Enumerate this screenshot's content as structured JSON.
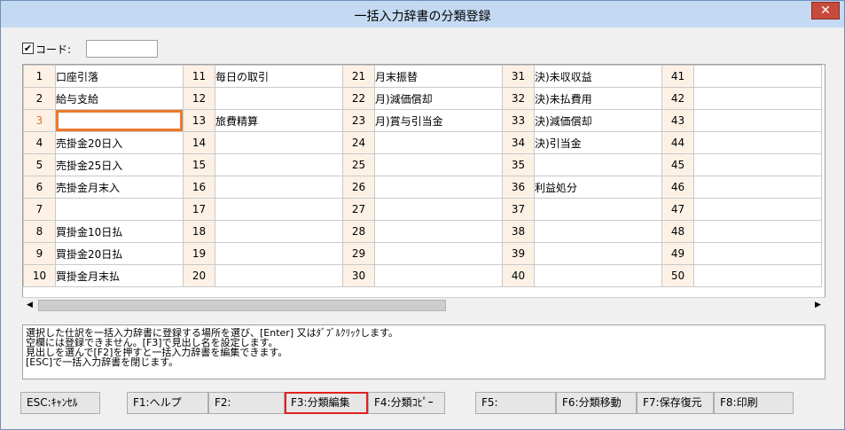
{
  "window": {
    "title": "一括入力辞書の分類登録",
    "close_glyph": "✕"
  },
  "code": {
    "checked": true,
    "check_glyph": "✔",
    "label": "コード:",
    "value": ""
  },
  "grid": {
    "columns": [
      [
        {
          "num": "1",
          "text": "口座引落"
        },
        {
          "num": "2",
          "text": "給与支給"
        },
        {
          "num": "3",
          "text": ""
        },
        {
          "num": "4",
          "text": "売掛金20日入"
        },
        {
          "num": "5",
          "text": "売掛金25日入"
        },
        {
          "num": "6",
          "text": "売掛金月末入"
        },
        {
          "num": "7",
          "text": ""
        },
        {
          "num": "8",
          "text": "買掛金10日払"
        },
        {
          "num": "9",
          "text": "買掛金20日払"
        },
        {
          "num": "10",
          "text": "買掛金月末払"
        }
      ],
      [
        {
          "num": "11",
          "text": "毎日の取引"
        },
        {
          "num": "12",
          "text": ""
        },
        {
          "num": "13",
          "text": "旅費精算"
        },
        {
          "num": "14",
          "text": ""
        },
        {
          "num": "15",
          "text": ""
        },
        {
          "num": "16",
          "text": ""
        },
        {
          "num": "17",
          "text": ""
        },
        {
          "num": "18",
          "text": ""
        },
        {
          "num": "19",
          "text": ""
        },
        {
          "num": "20",
          "text": ""
        }
      ],
      [
        {
          "num": "21",
          "text": "月末振替"
        },
        {
          "num": "22",
          "text": "月)減価償却"
        },
        {
          "num": "23",
          "text": "月)賞与引当金"
        },
        {
          "num": "24",
          "text": ""
        },
        {
          "num": "25",
          "text": ""
        },
        {
          "num": "26",
          "text": ""
        },
        {
          "num": "27",
          "text": ""
        },
        {
          "num": "28",
          "text": ""
        },
        {
          "num": "29",
          "text": ""
        },
        {
          "num": "30",
          "text": ""
        }
      ],
      [
        {
          "num": "31",
          "text": "決)未収収益"
        },
        {
          "num": "32",
          "text": "決)未払費用"
        },
        {
          "num": "33",
          "text": "決)減価償却"
        },
        {
          "num": "34",
          "text": "決)引当金"
        },
        {
          "num": "35",
          "text": ""
        },
        {
          "num": "36",
          "text": "利益処分"
        },
        {
          "num": "37",
          "text": ""
        },
        {
          "num": "38",
          "text": ""
        },
        {
          "num": "39",
          "text": ""
        },
        {
          "num": "40",
          "text": ""
        }
      ],
      [
        {
          "num": "41",
          "text": ""
        },
        {
          "num": "42",
          "text": ""
        },
        {
          "num": "43",
          "text": ""
        },
        {
          "num": "44",
          "text": ""
        },
        {
          "num": "45",
          "text": ""
        },
        {
          "num": "46",
          "text": ""
        },
        {
          "num": "47",
          "text": ""
        },
        {
          "num": "48",
          "text": ""
        },
        {
          "num": "49",
          "text": ""
        },
        {
          "num": "50",
          "text": ""
        }
      ]
    ],
    "selected_num": "3"
  },
  "scrollbar": {
    "left_arrow": "◀",
    "right_arrow": "▶"
  },
  "message_lines": [
    "選択した仕訳を一括入力辞書に登録する場所を選び、[Enter] 又はﾀﾞﾌﾞﾙｸﾘｯｸします。",
    "空欄には登録できません。[F3]で見出し名を設定します。",
    "見出しを選んで[F2]を押すと一括入力辞書を編集できます。",
    "[ESC]で一括入力辞書を閉じます。"
  ],
  "buttons": {
    "esc": "ESC:ｷｬﾝｾﾙ",
    "f1": "F1:ヘルプ",
    "f2": "F2:",
    "f3": "F3:分類編集",
    "f4": "F4:分類ｺﾋﾟｰ",
    "f5": "F5:",
    "f6": "F6:分類移動",
    "f7": "F7:保存復元",
    "f8": "F8:印刷"
  },
  "colors": {
    "selected_num": "#e07020",
    "editing_border": "#ec7a2c",
    "number_cell_bg": "#fdf1e6",
    "highlight_button_border": "#e02020"
  }
}
